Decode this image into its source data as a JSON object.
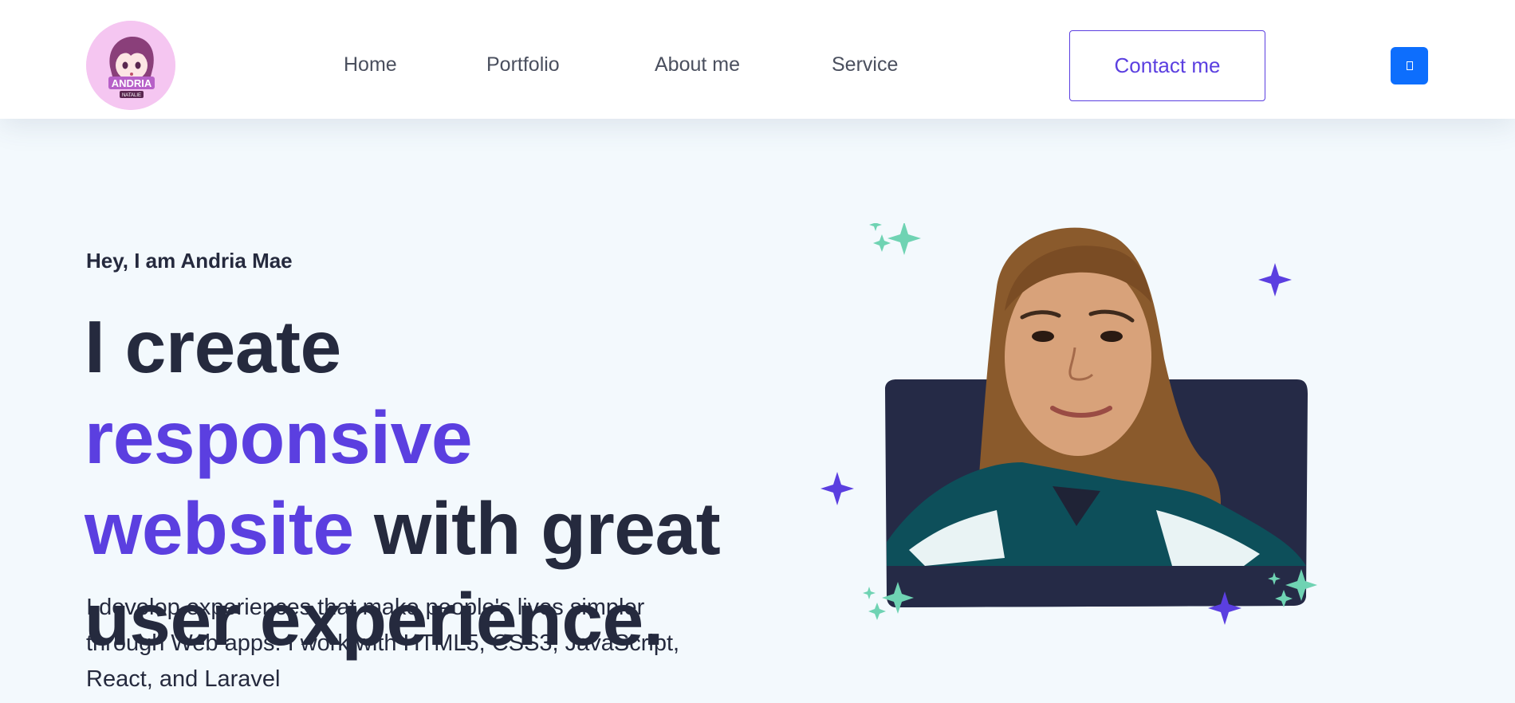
{
  "header": {
    "logo": {
      "text": "ANDRIA",
      "subtext": "NATALIE",
      "icon": "anime-avatar-logo"
    },
    "nav": [
      {
        "label": "Home"
      },
      {
        "label": "Portfolio"
      },
      {
        "label": "About me"
      },
      {
        "label": "Service"
      }
    ],
    "contact_label": "Contact me",
    "menu_icon": "menu-icon"
  },
  "hero": {
    "greeting": "Hey, I am Andria Mae",
    "headline": {
      "part1": "I create ",
      "accent": "responsive website",
      "part2": " with great user experience."
    },
    "description": "I develop experiences that make people's lives simpler through Web apps. I work with HTML5, CSS3, JavaScript, React, and Laravel",
    "image_icon": "profile-photo"
  },
  "colors": {
    "accent": "#5b3fe0",
    "dark": "#252a3e",
    "button_blue": "#0d6efd",
    "sparkle_teal": "#6fd3b3",
    "background": "#f3f9fd"
  }
}
